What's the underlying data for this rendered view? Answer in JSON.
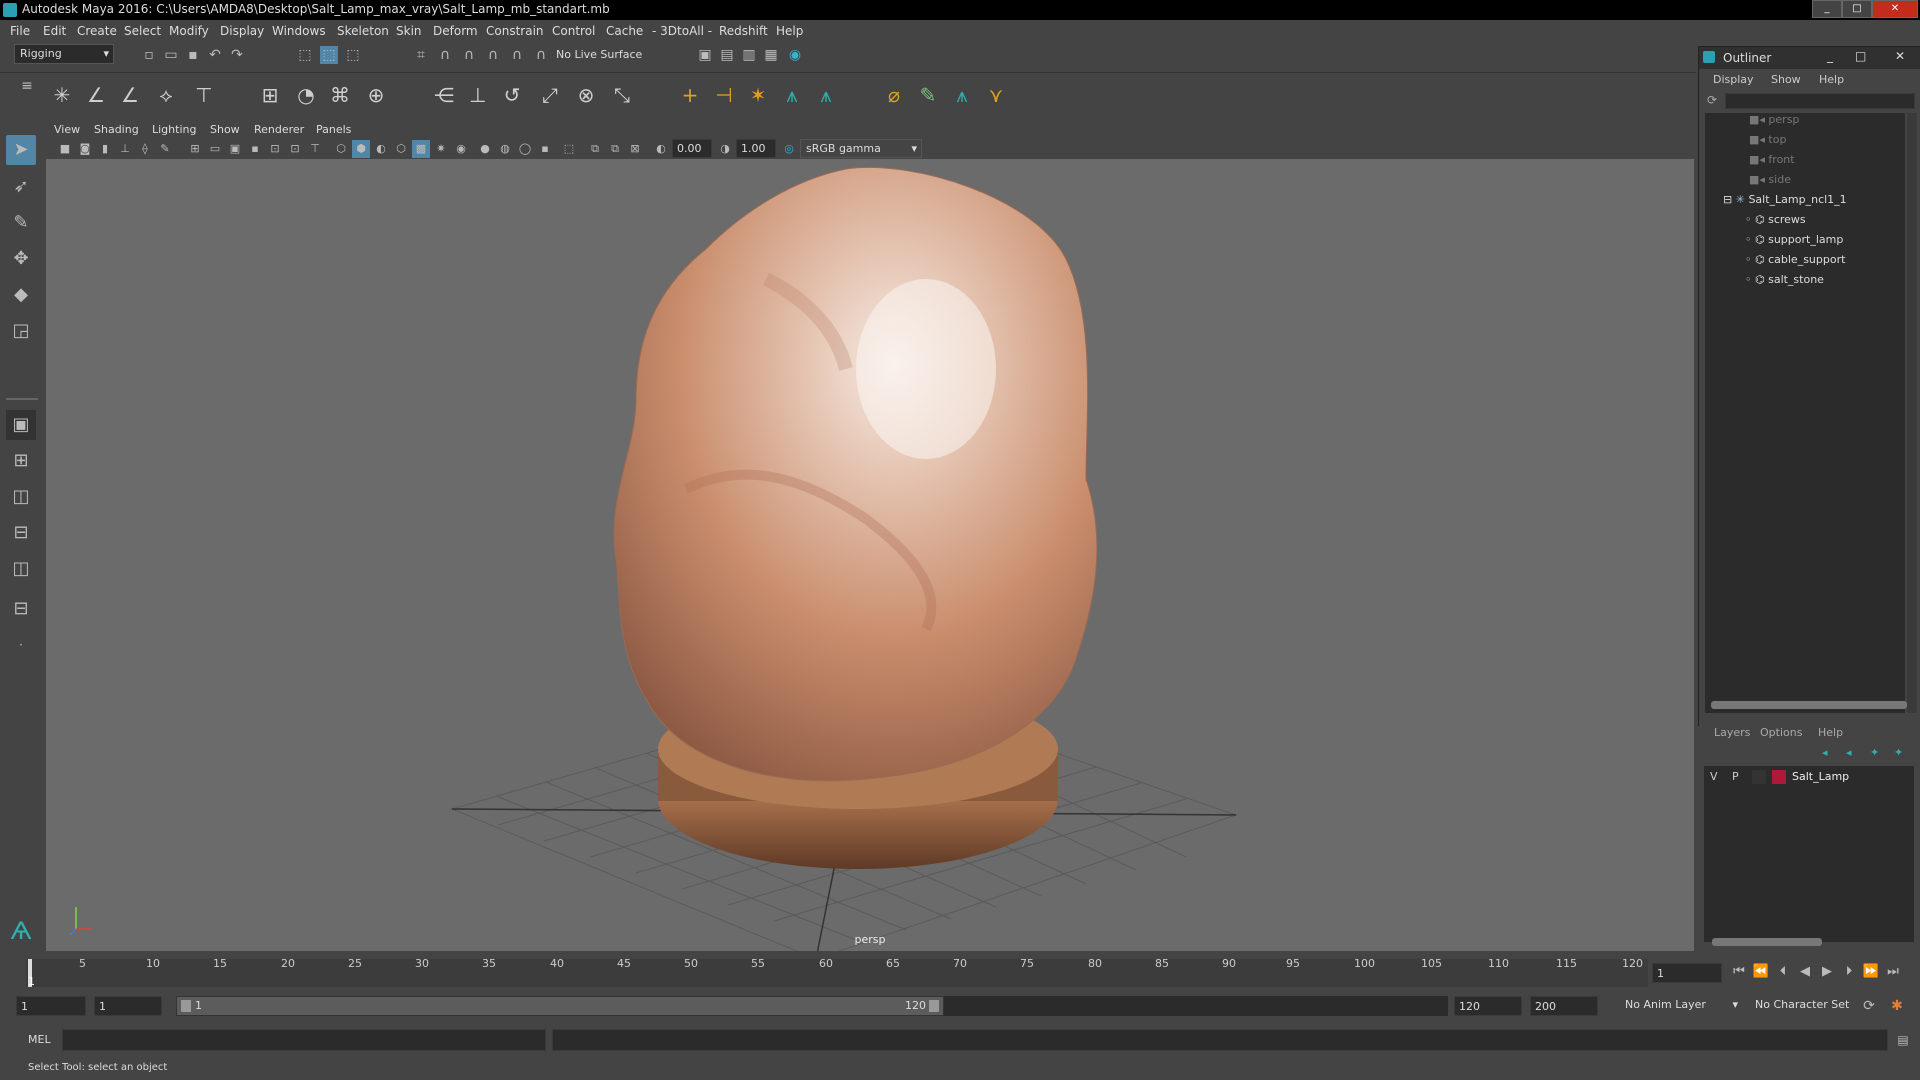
{
  "window": {
    "title": "Autodesk Maya 2016: C:\\Users\\AMDA8\\Desktop\\Salt_Lamp_max_vray\\Salt_Lamp_mb_standart.mb",
    "minimize": "_",
    "maximize": "□",
    "close": "✕"
  },
  "menubar": [
    "File",
    "Edit",
    "Create",
    "Select",
    "Modify",
    "Display",
    "Windows",
    "Skeleton",
    "Skin",
    "Deform",
    "Constrain",
    "Control",
    "Cache",
    "- 3DtoAll -",
    "Redshift",
    "Help"
  ],
  "statusline": {
    "mode": "Rigging",
    "live_surface": "No Live Surface"
  },
  "viewport": {
    "menu": [
      "View",
      "Shading",
      "Lighting",
      "Show",
      "Renderer",
      "Panels"
    ],
    "exposure": "0.00",
    "gamma": "1.00",
    "color_space": "sRGB gamma",
    "camera_label": "persp"
  },
  "outliner": {
    "title": "Outliner",
    "menu": [
      "Display",
      "Show",
      "Help"
    ],
    "items": [
      {
        "label": "persp",
        "depth": 0,
        "kind": "camera"
      },
      {
        "label": "top",
        "depth": 0,
        "kind": "camera"
      },
      {
        "label": "front",
        "depth": 0,
        "kind": "camera"
      },
      {
        "label": "side",
        "depth": 0,
        "kind": "camera"
      },
      {
        "label": "Salt_Lamp_ncl1_1",
        "depth": 0,
        "kind": "group"
      },
      {
        "label": "screws",
        "depth": 1,
        "kind": "mesh"
      },
      {
        "label": "support_lamp",
        "depth": 1,
        "kind": "mesh"
      },
      {
        "label": "cable_support",
        "depth": 1,
        "kind": "mesh"
      },
      {
        "label": "salt_stone",
        "depth": 1,
        "kind": "mesh"
      }
    ]
  },
  "layers": {
    "menu": [
      "Layers",
      "Options",
      "Help"
    ],
    "rows": [
      {
        "v": "V",
        "p": "P",
        "name": "Salt_Lamp",
        "color": "#b0183a"
      }
    ]
  },
  "timeline": {
    "ticks": [
      "5",
      "10",
      "15",
      "20",
      "25",
      "30",
      "35",
      "40",
      "45",
      "50",
      "55",
      "60",
      "65",
      "70",
      "75",
      "80",
      "85",
      "90",
      "95",
      "100",
      "105",
      "110",
      "115",
      "120"
    ],
    "current_frame": "1",
    "frame_field": "1"
  },
  "range": {
    "start": "1",
    "anim_start": "1",
    "range_start_label": "1",
    "range_end_label": "120",
    "end": "120",
    "anim_end": "200",
    "anim_layer": "No Anim Layer",
    "character_set": "No Character Set"
  },
  "command": {
    "label": "MEL"
  },
  "help": {
    "text": "Select Tool: select an object"
  }
}
